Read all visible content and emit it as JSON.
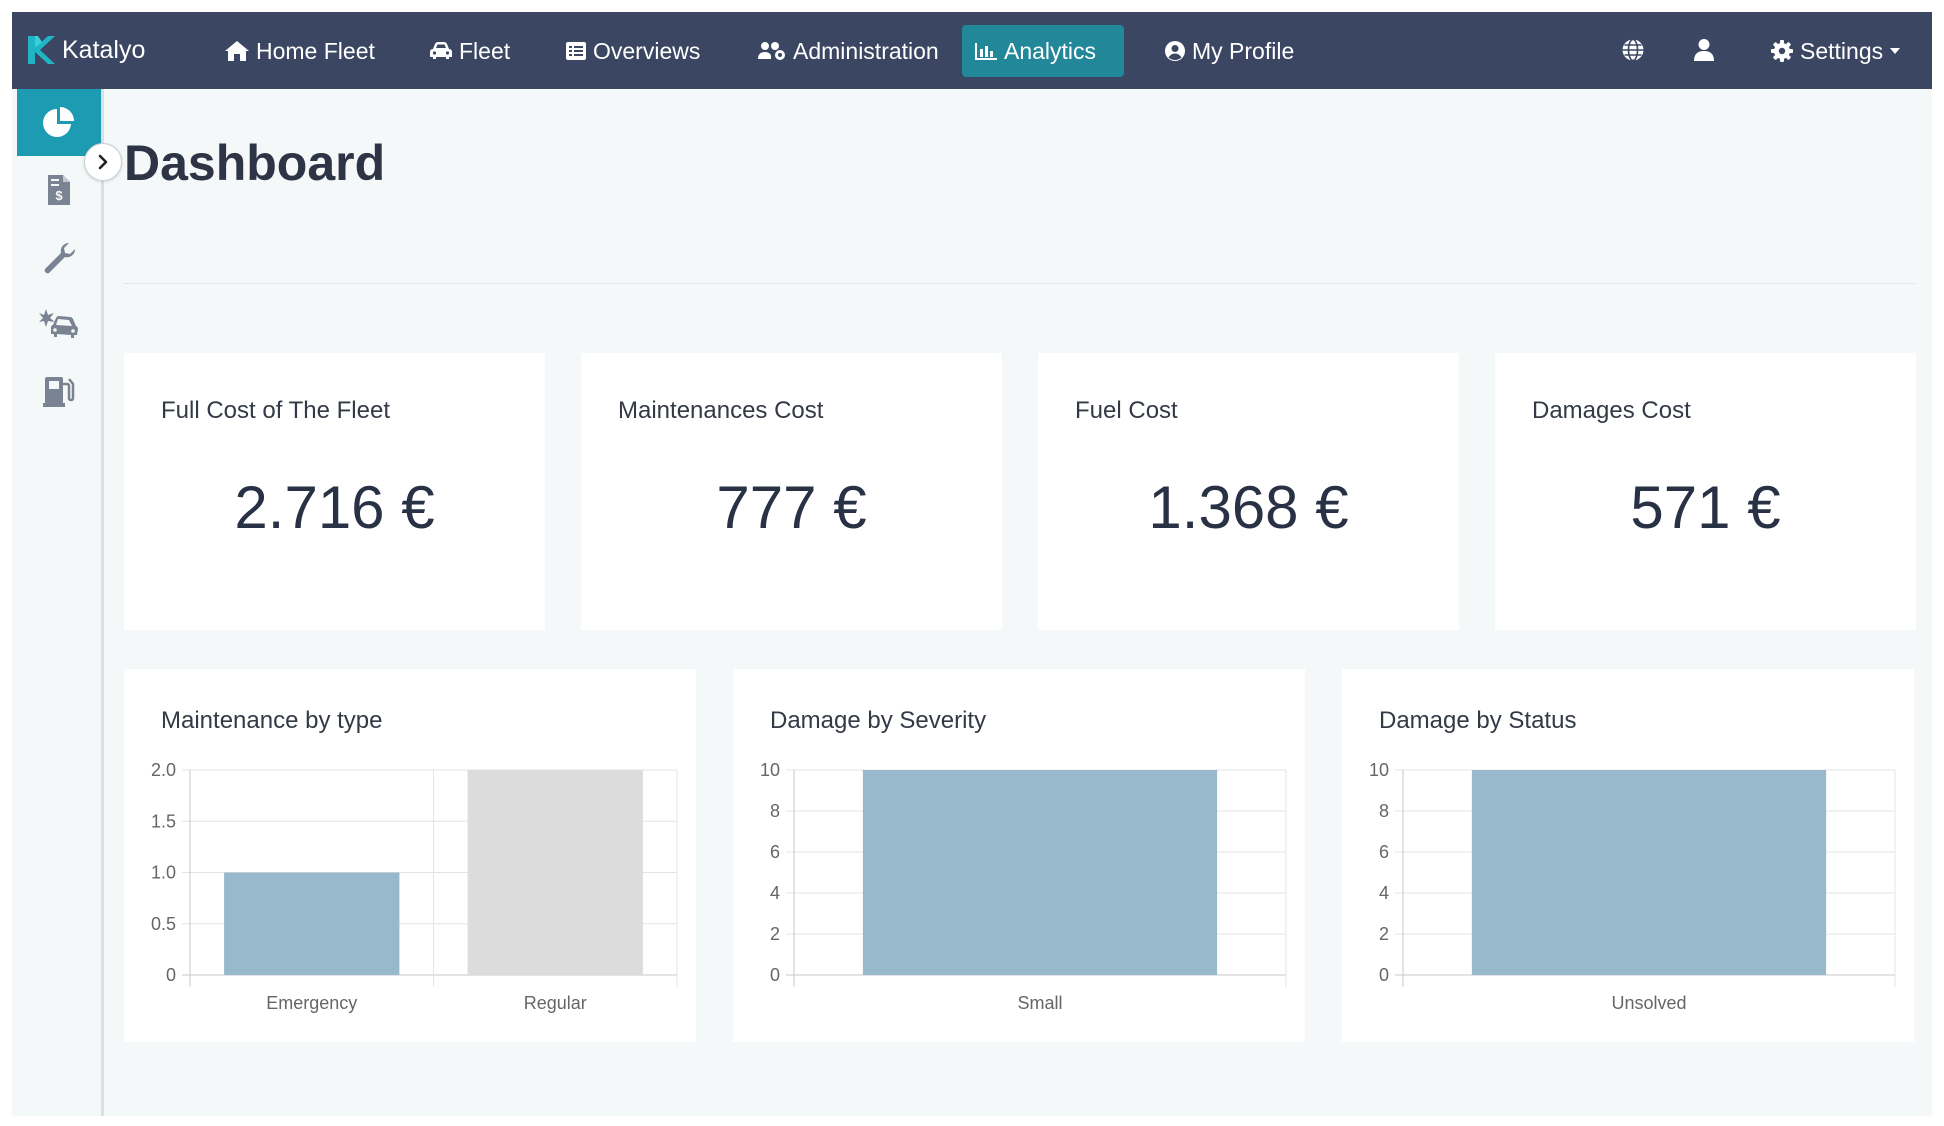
{
  "app": {
    "brand": "Katalyo"
  },
  "nav": {
    "home_fleet": "Home Fleet",
    "fleet": "Fleet",
    "overviews": "Overviews",
    "administration": "Administration",
    "analytics": "Analytics",
    "my_profile": "My Profile",
    "settings": "Settings",
    "active": "Analytics"
  },
  "sidebar": {
    "items": [
      "chart-pie-icon",
      "invoice-icon",
      "wrench-icon",
      "car-crash-icon",
      "gas-pump-icon"
    ],
    "active": "chart-pie-icon"
  },
  "page": {
    "title": "Dashboard"
  },
  "kpis": [
    {
      "label": "Full Cost of The Fleet",
      "value": "2.716 €"
    },
    {
      "label": "Maintenances Cost",
      "value": "777 €"
    },
    {
      "label": "Fuel Cost",
      "value": "1.368 €"
    },
    {
      "label": "Damages Cost",
      "value": "571 €"
    }
  ],
  "colors": {
    "nav_bg": "#3b4662",
    "accent": "#23879a",
    "sidebar_active": "#1d9bb3",
    "bar_blue": "#97b9cb",
    "bar_grey": "#dcdcdc"
  },
  "chart_data": [
    {
      "type": "bar",
      "title": "Maintenance by type",
      "categories": [
        "Emergency",
        "Regular"
      ],
      "values": [
        1,
        2
      ],
      "bar_colors": [
        "#97b9cb",
        "#dcdcdc"
      ],
      "ylim": [
        0,
        2
      ],
      "yticks": [
        "0",
        "0.5",
        "1.0",
        "1.5",
        "2.0"
      ],
      "grid": true
    },
    {
      "type": "bar",
      "title": "Damage by Severity",
      "categories": [
        "Small"
      ],
      "values": [
        10
      ],
      "bar_colors": [
        "#97b9cb"
      ],
      "ylim": [
        0,
        10
      ],
      "yticks": [
        "0",
        "2",
        "4",
        "6",
        "8",
        "10"
      ],
      "grid": true
    },
    {
      "type": "bar",
      "title": "Damage by Status",
      "categories": [
        "Unsolved"
      ],
      "values": [
        10
      ],
      "bar_colors": [
        "#97b9cb"
      ],
      "ylim": [
        0,
        10
      ],
      "yticks": [
        "0",
        "2",
        "4",
        "6",
        "8",
        "10"
      ],
      "grid": true
    }
  ]
}
